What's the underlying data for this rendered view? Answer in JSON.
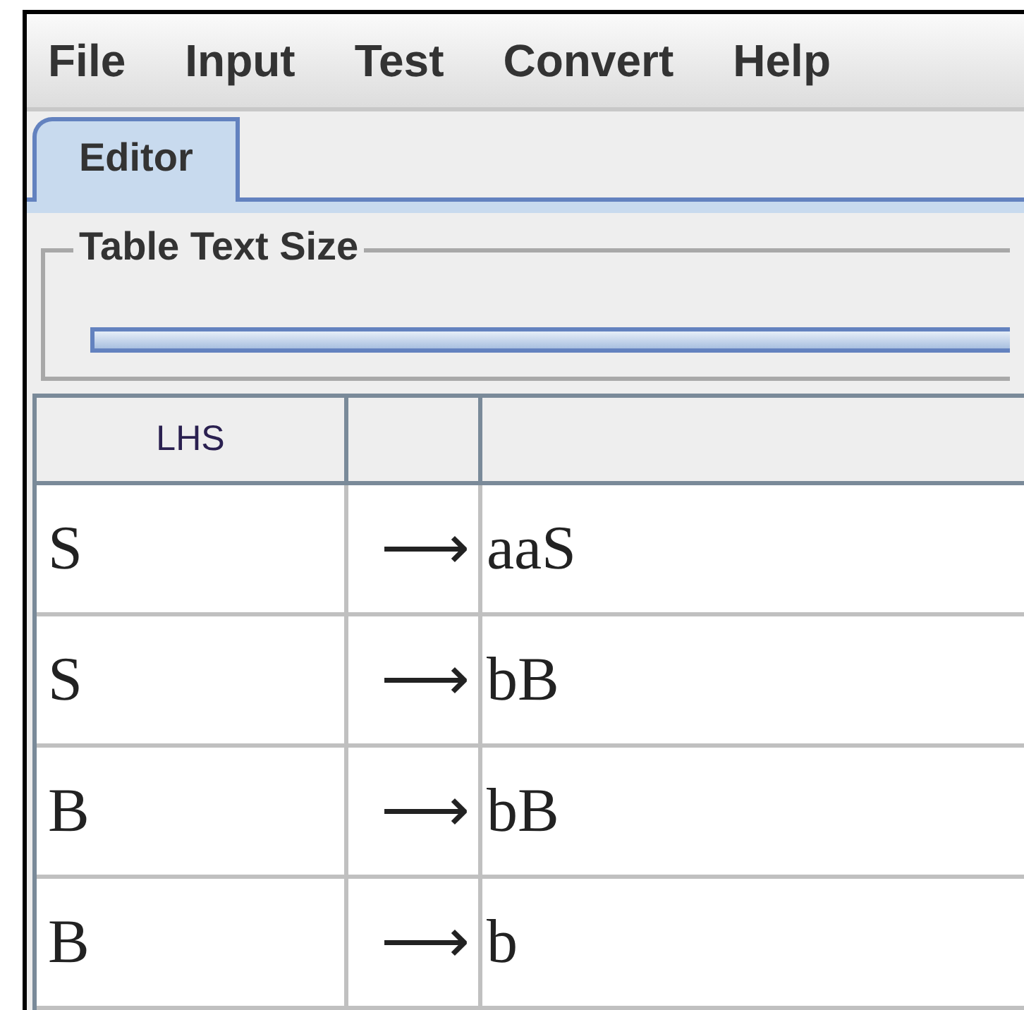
{
  "menu_bar": [
    "File",
    "Input",
    "Test",
    "Convert",
    "Help"
  ],
  "tabs": [
    {
      "label": "Editor",
      "selected": true
    }
  ],
  "slider_group": {
    "title": "Table Text Size"
  },
  "table": {
    "columns": [
      "LHS"
    ],
    "rows": [
      {
        "lhs": "S",
        "arrow": "⟶",
        "rhs": "aaS"
      },
      {
        "lhs": "S",
        "arrow": "⟶",
        "rhs": "bB"
      },
      {
        "lhs": "B",
        "arrow": "⟶",
        "rhs": "bB"
      },
      {
        "lhs": "B",
        "arrow": "⟶",
        "rhs": "b"
      }
    ]
  }
}
